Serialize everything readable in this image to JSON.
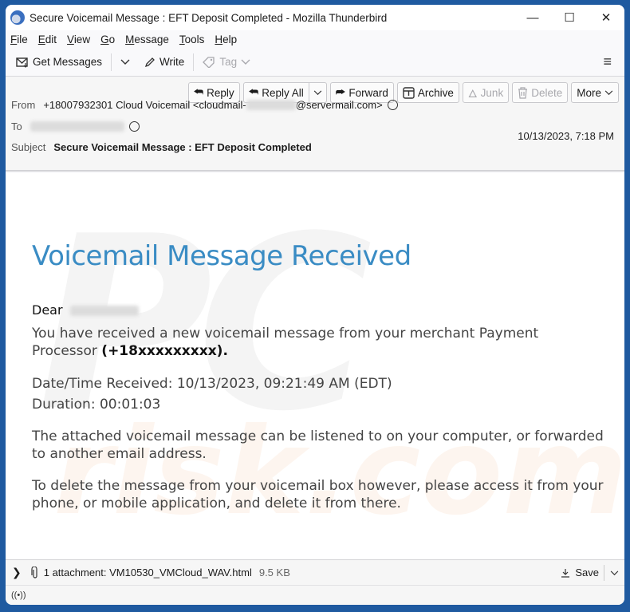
{
  "window": {
    "title": "Secure Voicemail Message : EFT Deposit Completed - Mozilla Thunderbird",
    "app_icon": "thunderbird-logo-icon",
    "controls": {
      "minimize": "—",
      "maximize": "☐",
      "close": "✕"
    }
  },
  "menubar": {
    "items": [
      {
        "label": "File",
        "accel": "F",
        "rest": "ile"
      },
      {
        "label": "Edit",
        "accel": "E",
        "rest": "dit"
      },
      {
        "label": "View",
        "accel": "V",
        "rest": "iew"
      },
      {
        "label": "Go",
        "accel": "G",
        "rest": "o"
      },
      {
        "label": "Message",
        "accel": "M",
        "rest": "essage"
      },
      {
        "label": "Tools",
        "accel": "T",
        "rest": "ools"
      },
      {
        "label": "Help",
        "accel": "H",
        "rest": "elp"
      }
    ]
  },
  "toolbar": {
    "get_messages": "Get Messages",
    "write": "Write",
    "tag": "Tag",
    "menu_icon": "≡"
  },
  "actions": {
    "reply": "Reply",
    "reply_all": "Reply All",
    "forward": "Forward",
    "archive": "Archive",
    "junk": "Junk",
    "delete": "Delete",
    "more": "More"
  },
  "header": {
    "from_label": "From",
    "from_prefix": "+18007932301 Cloud Voicemail <cloudmail-",
    "from_suffix": "@servermail.com>",
    "to_label": "To",
    "subject_label": "Subject",
    "subject": "Secure Voicemail Message : EFT Deposit Completed",
    "date": "10/13/2023, 7:18 PM"
  },
  "email": {
    "title": "Voicemail Message Received",
    "dear": "Dear",
    "p1_text": "You have received a new voicemail message from your merchant Payment Processor ",
    "p1_bold": "(+18xxxxxxxxx)",
    "p1_end": ".",
    "datetime": "Date/Time Received: 10/13/2023, 09:21:49 AM (EDT)",
    "duration": "Duration: 00:01:03",
    "p4": "The attached voicemail message can be listened to on your computer, or forwarded to another email address.",
    "p5": "To delete the message from your voicemail box however, please access it from your phone, or mobile application, and delete it from there."
  },
  "watermark": {
    "line1": "PC",
    "line2": "risk.com"
  },
  "attachment": {
    "label": "1 attachment: VM10530_VMCloud_WAV.html",
    "size": "9.5 KB",
    "save": "Save"
  },
  "status": {
    "icon": "((•))"
  }
}
